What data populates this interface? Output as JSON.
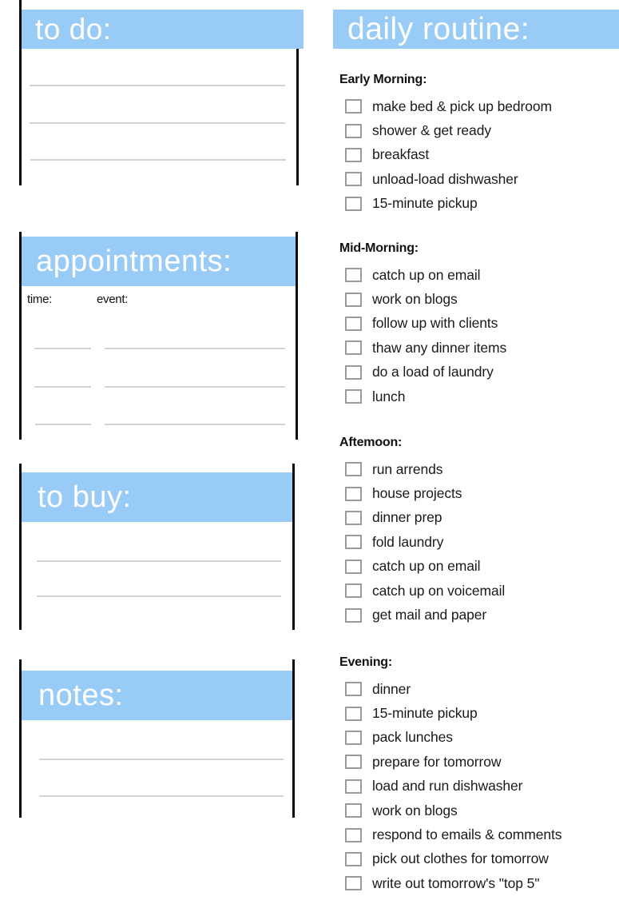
{
  "panels": {
    "todo": {
      "title": "to do:"
    },
    "appointments": {
      "title": "appointments:",
      "time_label": "time:",
      "event_label": "event:"
    },
    "to_buy": {
      "title": "to buy:"
    },
    "notes": {
      "title": "notes:"
    }
  },
  "routine": {
    "title": "daily routine:",
    "colors": {
      "header_band": "#99cbf7",
      "header_text": "#ffffff",
      "rule": "#d2d2d2",
      "checkbox_border": "#9a9a9a"
    },
    "sections": [
      {
        "title": "Early Morning:",
        "tasks": [
          "make bed & pick up bedroom",
          "shower & get ready",
          "breakfast",
          "unload-load dishwasher",
          "15-minute pickup"
        ]
      },
      {
        "title": "Mid-Morning:",
        "tasks": [
          "catch up on email",
          "work on blogs",
          "follow up with clients",
          "thaw any dinner items",
          "do a load of laundry",
          "lunch"
        ]
      },
      {
        "title": "Aftemoon:",
        "tasks": [
          "run arrends",
          "house projects",
          "dinner prep",
          "fold laundry",
          "catch up on email",
          "catch up on voicemail",
          "get mail and paper"
        ]
      },
      {
        "title": "Evening:",
        "tasks": [
          "dinner",
          "15-minute pickup",
          "pack lunches",
          "prepare for tomorrow",
          "load and run dishwasher",
          "work on blogs",
          "respond to emails & comments",
          "pick out clothes for tomorrow",
          "write out tomorrow's \"top 5\""
        ]
      }
    ]
  }
}
